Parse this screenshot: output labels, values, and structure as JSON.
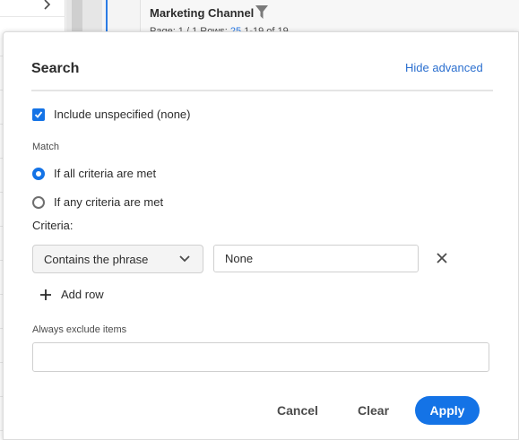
{
  "background": {
    "panel_title": "Marketing Channel",
    "subtitle": {
      "page_label": "Page: 1 / 1",
      "rows_label": "Rows:",
      "rows_value": "25",
      "range_label": "1-19 of 19"
    },
    "icons": [
      "chevron-right-icon",
      "filter-icon"
    ]
  },
  "dialog": {
    "title": "Search",
    "hide_advanced": "Hide advanced",
    "include_unspecified": {
      "label": "Include unspecified (none)",
      "checked": true
    },
    "match": {
      "label": "Match",
      "options": [
        {
          "label": "If all criteria are met",
          "selected": true
        },
        {
          "label": "If any criteria are met",
          "selected": false
        }
      ]
    },
    "criteria": {
      "label": "Criteria:",
      "rows": [
        {
          "operator": "Contains the phrase",
          "value": "None"
        }
      ],
      "add_row": "Add row"
    },
    "exclude": {
      "label": "Always exclude items",
      "value": ""
    },
    "buttons": {
      "cancel": "Cancel",
      "clear": "Clear",
      "apply": "Apply"
    }
  },
  "colors": {
    "accent": "#1473e6",
    "link": "#2b6fcf",
    "text": "#2c2c2c"
  }
}
